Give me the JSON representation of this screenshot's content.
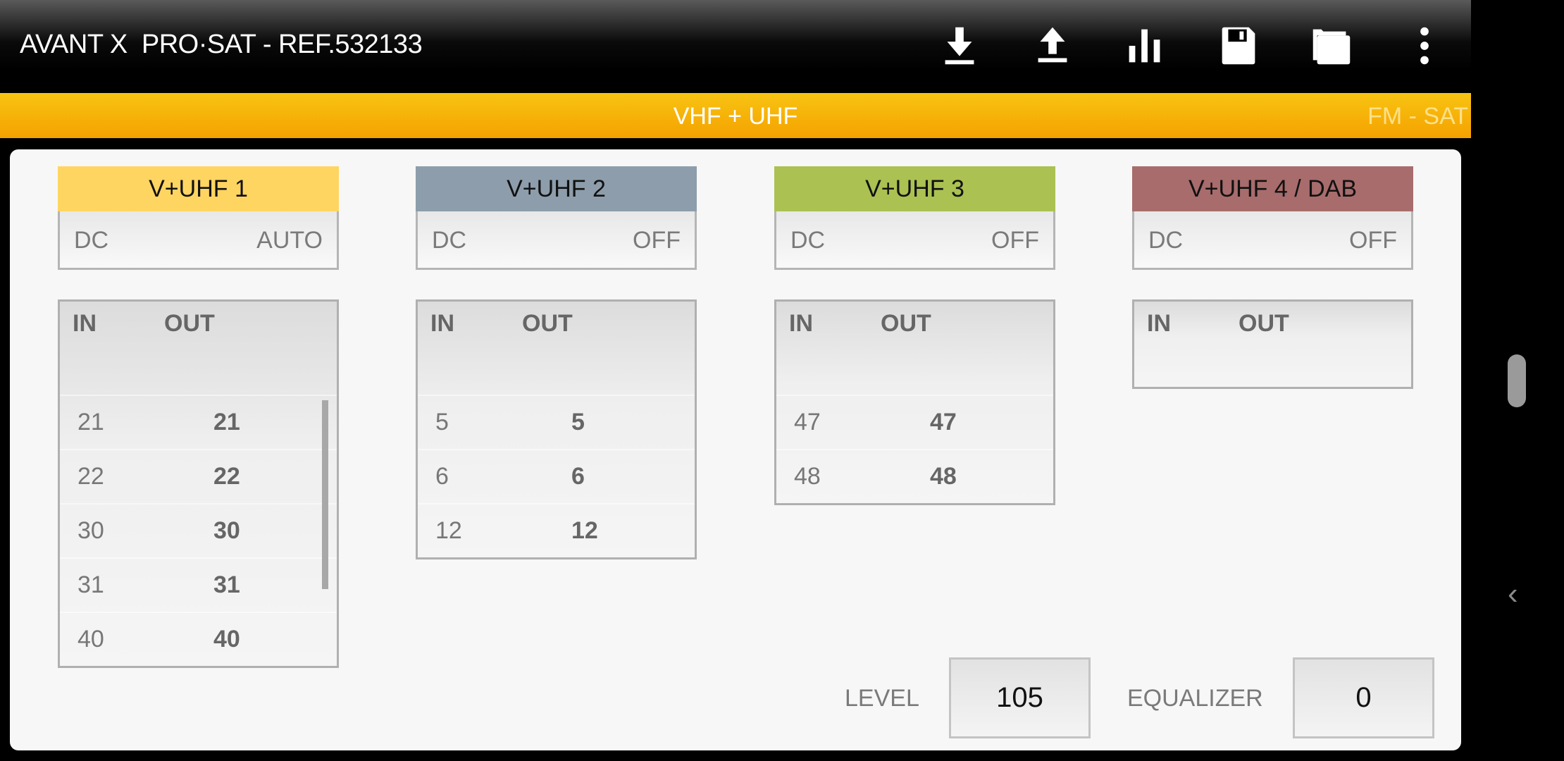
{
  "header": {
    "title": "AVANT X  PRO·SAT - REF.532133",
    "icons": [
      "download-icon",
      "upload-icon",
      "bar-chart-icon",
      "save-icon",
      "folder-icon",
      "more-vert-icon"
    ]
  },
  "tabs": {
    "active": "VHF + UHF",
    "next": "FM - SAT",
    "accent": "#f5a100"
  },
  "groups": [
    {
      "name": "V+UHF 1",
      "color": "#ffd561",
      "dc_label": "DC",
      "dc_value": "AUTO",
      "in_label": "IN",
      "out_label": "OUT",
      "rows": [
        {
          "in": "21",
          "out": "21"
        },
        {
          "in": "22",
          "out": "22"
        },
        {
          "in": "30",
          "out": "30"
        },
        {
          "in": "31",
          "out": "31"
        },
        {
          "in": "40",
          "out": "40"
        }
      ]
    },
    {
      "name": "V+UHF 2",
      "color": "#8d9dab",
      "dc_label": "DC",
      "dc_value": "OFF",
      "in_label": "IN",
      "out_label": "OUT",
      "rows": [
        {
          "in": "5",
          "out": "5"
        },
        {
          "in": "6",
          "out": "6"
        },
        {
          "in": "12",
          "out": "12"
        }
      ]
    },
    {
      "name": "V+UHF 3",
      "color": "#abc152",
      "dc_label": "DC",
      "dc_value": "OFF",
      "in_label": "IN",
      "out_label": "OUT",
      "rows": [
        {
          "in": "47",
          "out": "47"
        },
        {
          "in": "48",
          "out": "48"
        }
      ]
    },
    {
      "name": "V+UHF 4 / DAB",
      "color": "#a86c6c",
      "dc_label": "DC",
      "dc_value": "OFF",
      "in_label": "IN",
      "out_label": "OUT",
      "rows": []
    }
  ],
  "footer": {
    "level_label": "LEVEL",
    "level_value": "105",
    "equalizer_label": "EQUALIZER",
    "equalizer_value": "0"
  }
}
